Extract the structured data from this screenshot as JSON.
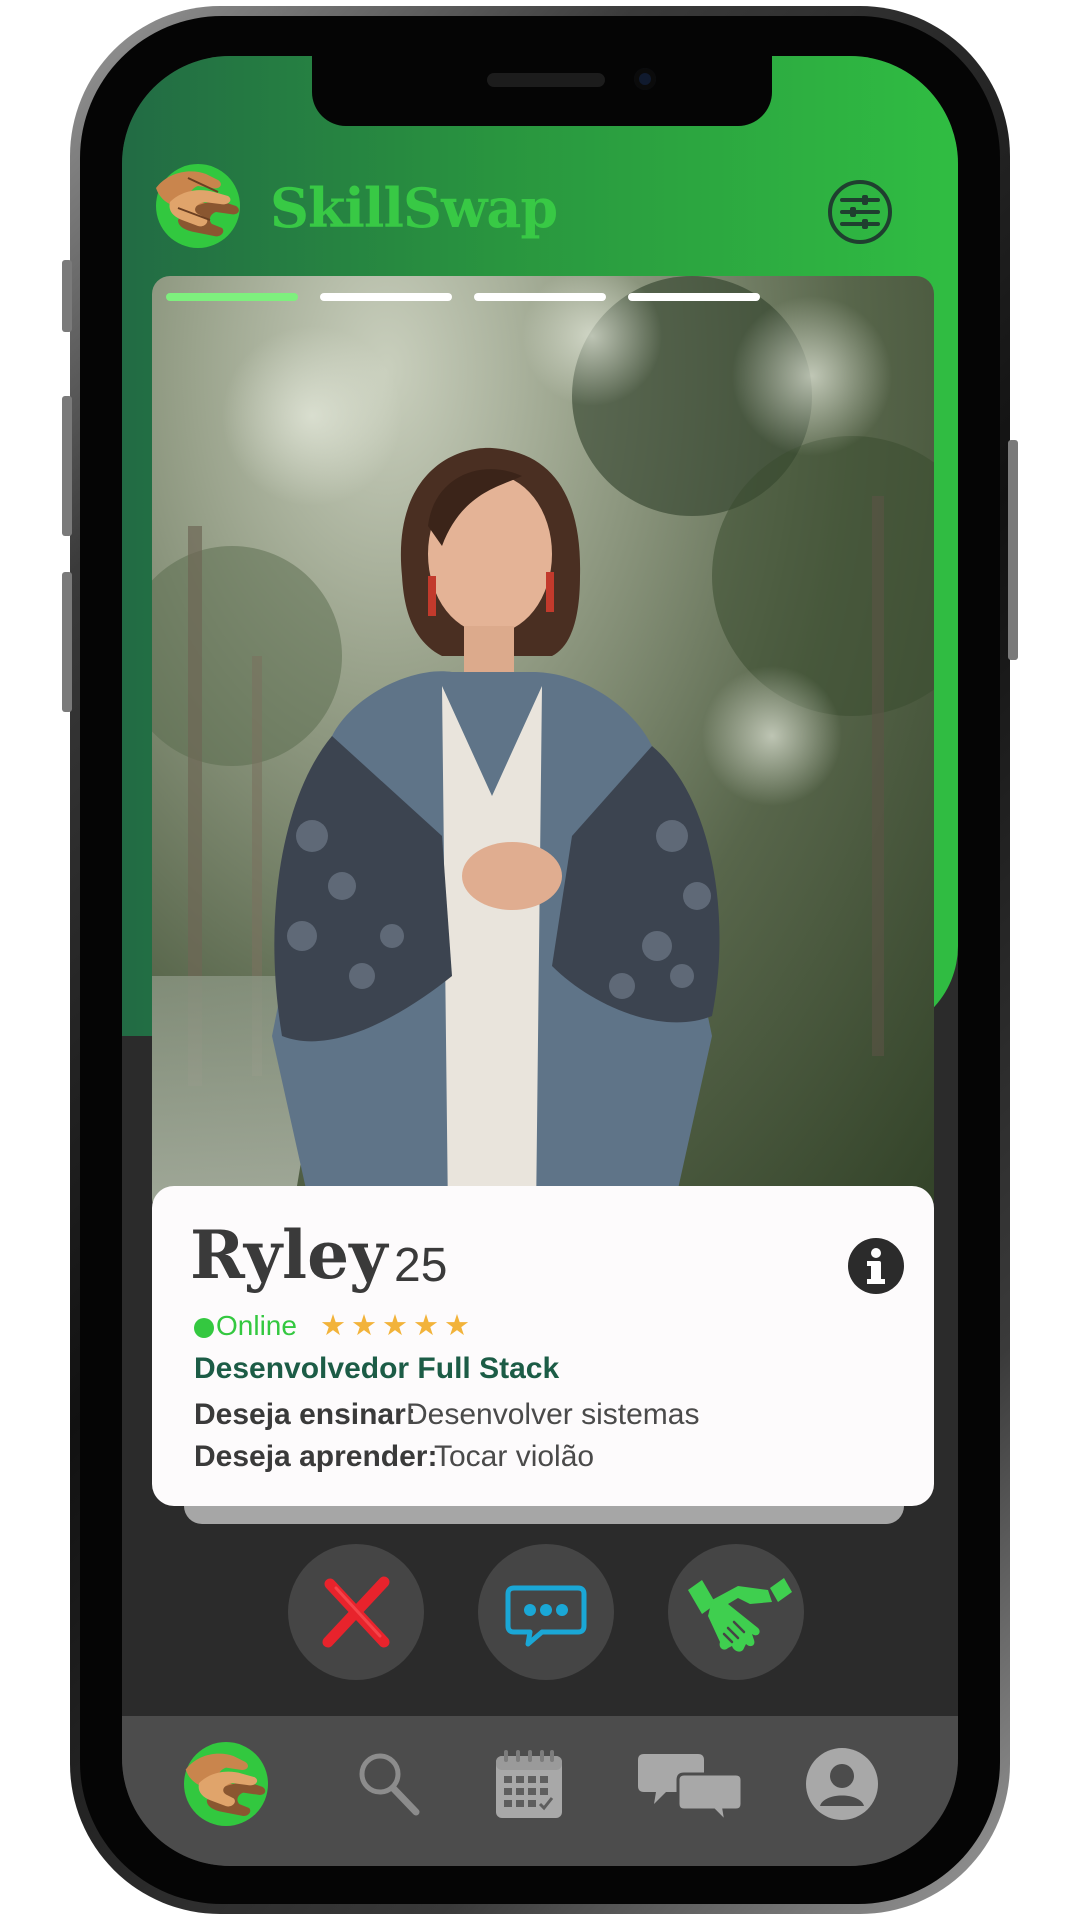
{
  "app": {
    "title": "SkillSwap"
  },
  "profile": {
    "name": "Ryley",
    "age": "25",
    "status": "Online",
    "rating_stars": "★★★★★",
    "rating": 5,
    "profession": "Desenvolvedor Full Stack",
    "teach_label": "Deseja ensinar:",
    "teach_value": "Desenvolver sistemas",
    "learn_label": "Deseja aprender:",
    "learn_value": "Tocar violão",
    "photo_index": 1,
    "photo_count": 4
  },
  "actions": {
    "reject": "x-icon",
    "message": "chat-bubble-icon",
    "match": "handshake-icon"
  },
  "tabs": [
    {
      "icon": "skillswap-logo-icon",
      "active": true
    },
    {
      "icon": "search-icon"
    },
    {
      "icon": "calendar-icon"
    },
    {
      "icon": "chat-bubbles-icon"
    },
    {
      "icon": "profile-icon"
    }
  ],
  "colors": {
    "brand_green": "#38c945",
    "header_dark_green": "#226b44",
    "profession_text": "#1c5c46",
    "star": "#f2b33a",
    "reject_red": "#e8232c",
    "message_blue": "#1aa7d6",
    "progress_active": "#7ef07e"
  }
}
